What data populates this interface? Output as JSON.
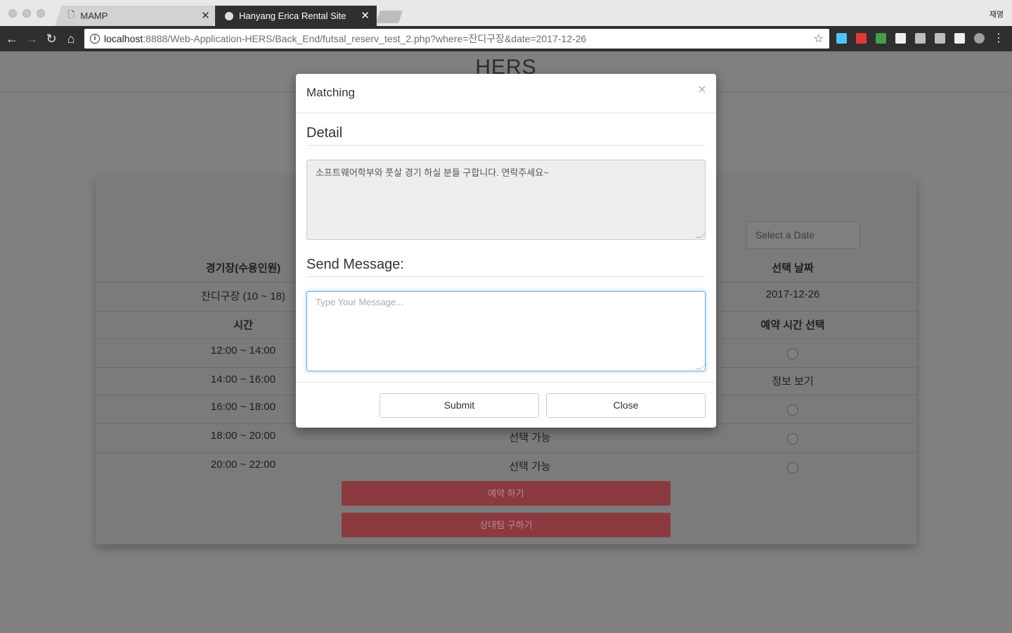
{
  "browser": {
    "profile": "재영",
    "tabs": [
      {
        "title": "MAMP",
        "close": "✕"
      },
      {
        "title": "Hanyang Erica Rental Site",
        "close": "✕"
      }
    ],
    "url_host": "localhost",
    "url_rest": ":8888/Web-Application-HERS/Back_End/futsal_reserv_test_2.php?where=잔디구장&date=2017-12-26",
    "nav": {
      "back": "←",
      "forward": "→",
      "reload": "↻",
      "home": "⌂",
      "star": "☆"
    },
    "extension_colors": [
      "#4fc3f7",
      "#e53935",
      "#43a047",
      "#eeeeee",
      "#bdbdbd",
      "#bdbdbd",
      "#eeeeee",
      "#9e9e9e"
    ]
  },
  "page": {
    "site_title": "HERS",
    "date_placeholder": "Select a Date",
    "headers": {
      "field": "경기장(수용인원)",
      "date": "선택 날짜"
    },
    "field_value": "잔디구장 (10 ~ 18)",
    "date_value": "2017-12-26",
    "subheaders": {
      "time": "시간",
      "select": "예약 시간 선택"
    },
    "slots": [
      {
        "time": "12:00 ~ 14:00",
        "status": "",
        "action": "radio"
      },
      {
        "time": "14:00 ~ 16:00",
        "status": "",
        "action": "정보 보기"
      },
      {
        "time": "16:00 ~ 18:00",
        "status": "",
        "action": "radio"
      },
      {
        "time": "18:00 ~ 20:00",
        "status": "선택 가능",
        "action": "radio"
      },
      {
        "time": "20:00 ~ 22:00",
        "status": "선택 가능",
        "action": "radio"
      }
    ],
    "reserve_button": "예약 하기",
    "find_team_button": "상대팀 구하기"
  },
  "modal": {
    "title": "Matching",
    "close": "×",
    "detail_title": "Detail",
    "detail_text": "소프트웨어학부와 풋살 경기 하실 분들 구합니다. 연락주세요~",
    "send_title": "Send Message:",
    "message_placeholder": "Type Your Message...",
    "submit": "Submit",
    "close_button": "Close"
  }
}
